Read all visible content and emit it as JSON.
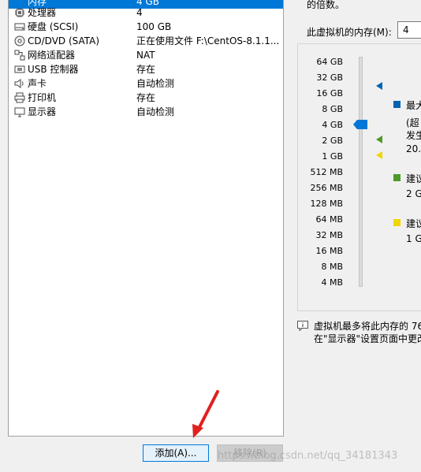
{
  "devices": [
    {
      "name": "内存",
      "summary": "4 GB",
      "icon": "memory-icon"
    },
    {
      "name": "处理器",
      "summary": "4",
      "icon": "cpu-icon"
    },
    {
      "name": "硬盘 (SCSI)",
      "summary": "100 GB",
      "icon": "hard-disk-icon"
    },
    {
      "name": "CD/DVD (SATA)",
      "summary": "正在使用文件 F:\\CentOS-8.1.1...",
      "icon": "cd-dvd-icon"
    },
    {
      "name": "网络适配器",
      "summary": "NAT",
      "icon": "network-adapter-icon"
    },
    {
      "name": "USB 控制器",
      "summary": "存在",
      "icon": "usb-icon"
    },
    {
      "name": "声卡",
      "summary": "自动检测",
      "icon": "speaker-icon"
    },
    {
      "name": "打印机",
      "summary": "存在",
      "icon": "printer-icon"
    },
    {
      "name": "显示器",
      "summary": "自动检测",
      "icon": "monitor-icon"
    }
  ],
  "buttons": {
    "add": "添加(A)...",
    "remove": "移除(R)"
  },
  "memory": {
    "multiple_text": "的倍数。",
    "label": "此虚拟机的内存(M):",
    "value": "4",
    "ticks": [
      "64 GB",
      "32 GB",
      "16 GB",
      "8 GB",
      "4 GB",
      "2 GB",
      "1 GB",
      "512 MB",
      "256 MB",
      "128 MB",
      "64 MB",
      "32 MB",
      "16 MB",
      "8 MB",
      "4 MB"
    ],
    "current": "4 GB",
    "legend": {
      "max_label": "最大",
      "max_note": "(超",
      "max_note2": "发生",
      "max_value": "20.",
      "recommended_label": "建议",
      "recommended_value": "2 G",
      "min_label": "建议",
      "min_value": "1 G"
    },
    "colors": {
      "max": "#0063b1",
      "recommended": "#4c9a2a",
      "min": "#f2d600"
    }
  },
  "info": {
    "line1": "虚拟机最多将此内存的 76",
    "line2": "在\"显示器\"设置页面中更改"
  },
  "watermark": "https://blog.csdn.net/qq_34181343",
  "annotation_color": "#e02020"
}
